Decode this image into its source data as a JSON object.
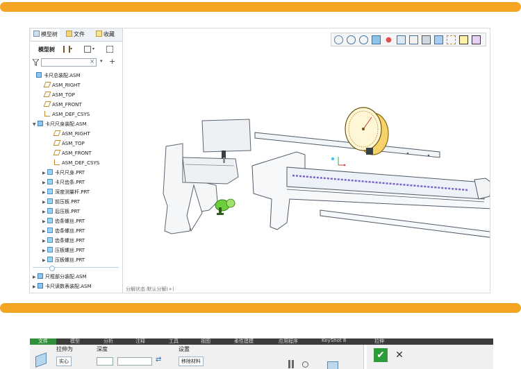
{
  "colors": {
    "accent_bar": "#f5a524",
    "ribbon_dark": "#3c3c3c",
    "file_tab": "#2f8f3a"
  },
  "tabs": {
    "model_tree": "模型树",
    "files": "文件",
    "favorites": "收藏"
  },
  "tree_toolbar": {
    "label": "模型树"
  },
  "search": {
    "placeholder": "",
    "clear": "×",
    "add": "+"
  },
  "tree": [
    {
      "label": "卡尺总装配.ASM",
      "icon": "assembly-icon",
      "expander": ""
    },
    {
      "label": "ASM_RIGHT",
      "icon": "datum-plane-icon",
      "expander": ""
    },
    {
      "label": "ASM_TOP",
      "icon": "datum-plane-icon",
      "expander": ""
    },
    {
      "label": "ASM_FRONT",
      "icon": "datum-plane-icon",
      "expander": ""
    },
    {
      "label": "ASM_DEF_CSYS",
      "icon": "csys-icon",
      "expander": ""
    },
    {
      "label": "卡尺尺身装配.ASM",
      "icon": "assembly-icon",
      "expander": "▼"
    },
    {
      "label": "ASM_RIGHT",
      "icon": "datum-plane-icon",
      "expander": ""
    },
    {
      "label": "ASM_TOP",
      "icon": "datum-plane-icon",
      "expander": ""
    },
    {
      "label": "ASM_FRONT",
      "icon": "datum-plane-icon",
      "expander": ""
    },
    {
      "label": "ASM_DEF_CSYS",
      "icon": "csys-icon",
      "expander": ""
    },
    {
      "label": "卡尺尺身.PRT",
      "icon": "part-icon",
      "expander": "▶"
    },
    {
      "label": "卡尺齿条.PRT",
      "icon": "part-icon",
      "expander": "▶"
    },
    {
      "label": "深度测量杆.PRT",
      "icon": "part-icon",
      "expander": "▶"
    },
    {
      "label": "前压板.PRT",
      "icon": "part-icon",
      "expander": "▶"
    },
    {
      "label": "后压板.PRT",
      "icon": "part-icon",
      "expander": "▶"
    },
    {
      "label": "齿条螺丝.PRT",
      "icon": "part-icon",
      "expander": "▶"
    },
    {
      "label": "齿条螺丝.PRT",
      "icon": "part-icon",
      "expander": "▶"
    },
    {
      "label": "齿条螺丝.PRT",
      "icon": "part-icon",
      "expander": "▶"
    },
    {
      "label": "压板螺丝.PRT",
      "icon": "part-icon",
      "expander": "▶"
    },
    {
      "label": "压板螺丝.PRT",
      "icon": "part-icon",
      "expander": "▶"
    },
    {
      "label": "尺框部分装配.ASM",
      "icon": "assembly-icon",
      "expander": "▶"
    },
    {
      "label": "卡尺读数表装配.ASM",
      "icon": "assembly-icon",
      "expander": "▶"
    }
  ],
  "status": "分解状态:默认分解(+)",
  "ribbon": {
    "tabs": [
      "文件",
      "模型",
      "分析",
      "注释",
      "工具",
      "视图",
      "柔性建模",
      "应用程序",
      "KeyShot 8",
      "拉伸"
    ],
    "extrude_as": "拉伸为",
    "solid": "实心",
    "depth": "深度",
    "settings": "设置",
    "remove_material": "移除材料",
    "ok": "✔",
    "cancel": "✕"
  }
}
